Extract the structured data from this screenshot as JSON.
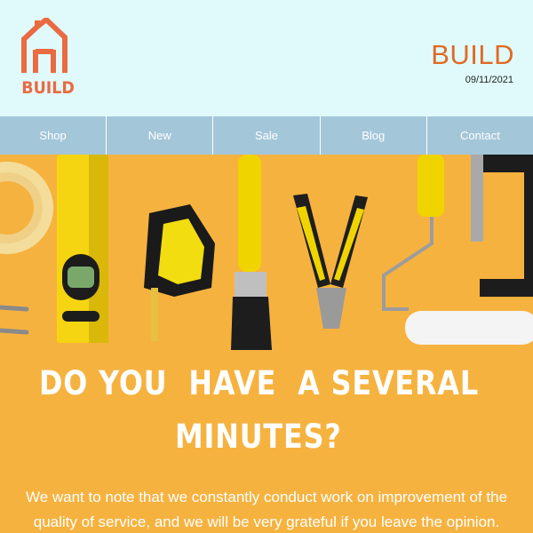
{
  "header": {
    "logo_text": "BUILD",
    "brand": "BUILD",
    "date": "09/11/2021"
  },
  "nav": {
    "items": [
      "Shop",
      "New",
      "Sale",
      "Blog",
      "Contact"
    ]
  },
  "hero": {
    "headline_line1": "DO YOU  HAVE  A SEVERAL",
    "headline_line2": "MINUTES?",
    "body": "We want to note that we constantly conduct work on improvement of the quality of service, and we will be very grateful if you leave the opinion."
  },
  "colors": {
    "header_bg": "#e0fafb",
    "nav_bg": "#a4c6d9",
    "hero_bg": "#f6b23f",
    "brand": "#e06a23",
    "logo": "#ea6a42"
  },
  "icons": [
    "house-logo-icon",
    "tape-roll-icon",
    "spirit-level-icon",
    "tape-measure-icon",
    "paint-brush-icon",
    "pliers-icon",
    "paint-roller-icon",
    "clamp-icon",
    "screw-icon"
  ]
}
